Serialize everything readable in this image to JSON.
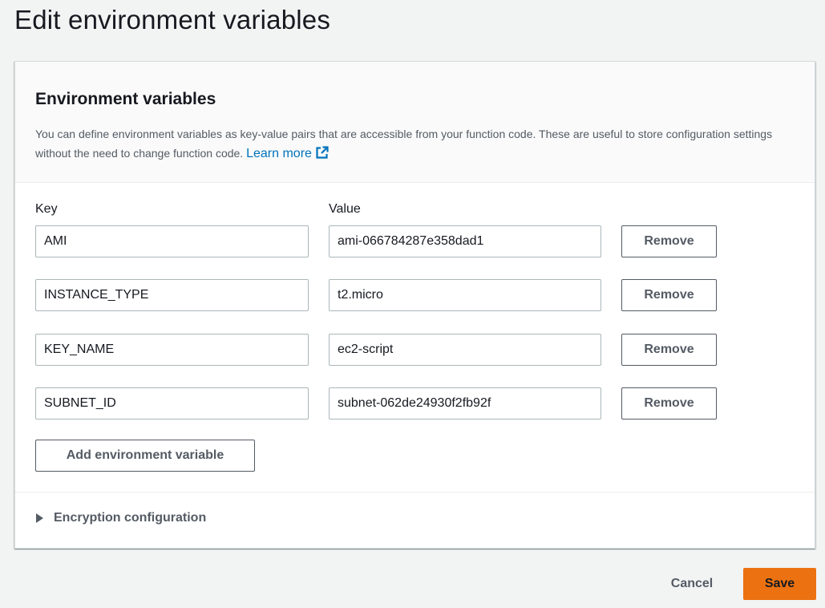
{
  "page": {
    "title": "Edit environment variables"
  },
  "panel": {
    "title": "Environment variables",
    "description": "You can define environment variables as key-value pairs that are accessible from your function code. These are useful to store configuration settings without the need to change function code.",
    "learn_more": "Learn more",
    "learn_more_icon": "external-link-icon"
  },
  "columns": {
    "key_label": "Key",
    "value_label": "Value"
  },
  "variables": [
    {
      "key": "AMI",
      "value": "ami-066784287e358dad1",
      "remove_label": "Remove"
    },
    {
      "key": "INSTANCE_TYPE",
      "value": "t2.micro",
      "remove_label": "Remove"
    },
    {
      "key": "KEY_NAME",
      "value": "ec2-script",
      "remove_label": "Remove"
    },
    {
      "key": "SUBNET_ID",
      "value": "subnet-062de24930f2fb92f",
      "remove_label": "Remove"
    }
  ],
  "add_button_label": "Add environment variable",
  "encryption": {
    "label": "Encryption configuration",
    "icon": "caret-right-icon",
    "expanded": false
  },
  "footer": {
    "cancel_label": "Cancel",
    "save_label": "Save"
  },
  "colors": {
    "primary_button": "#ec7211",
    "link": "#0073bb",
    "background": "#f2f3f3"
  }
}
